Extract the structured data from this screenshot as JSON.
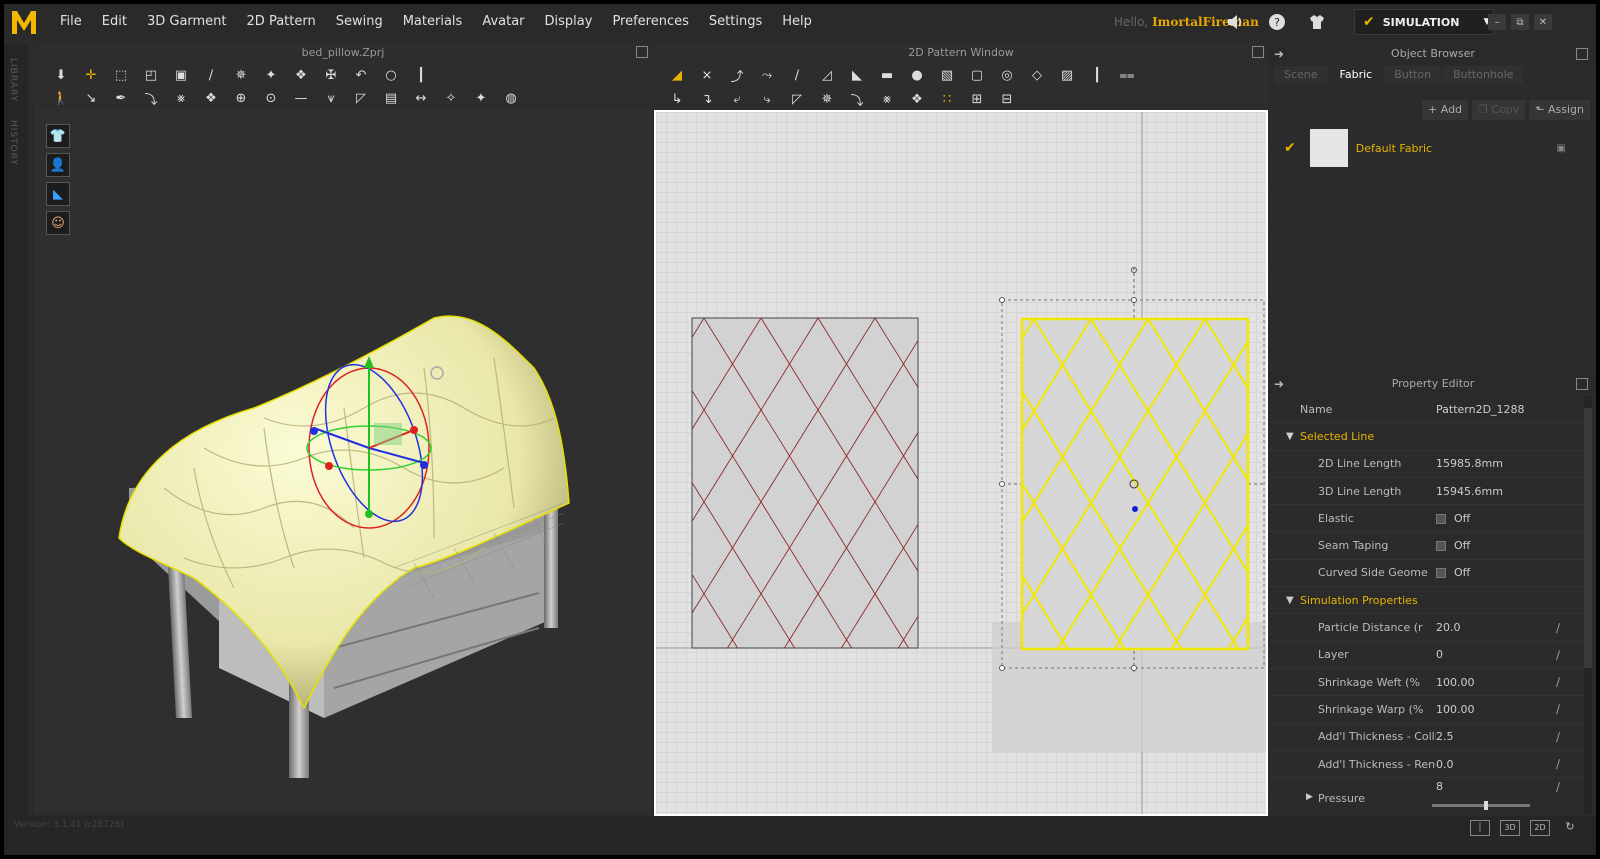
{
  "app": {
    "menu": [
      "File",
      "Edit",
      "3D Garment",
      "2D Pattern",
      "Sewing",
      "Materials",
      "Avatar",
      "Display",
      "Preferences",
      "Settings",
      "Help"
    ],
    "hello_prefix": "Hello,",
    "user_name": "ImortalFireman",
    "mode_label": "SIMULATION",
    "accent_color": "#e8b400"
  },
  "side_tabs": [
    "LIBRARY",
    "HISTORY"
  ],
  "viewport3d": {
    "title": "bed_pillow.Zprj"
  },
  "viewport2d": {
    "title": "2D Pattern Window"
  },
  "object_browser": {
    "title": "Object Browser",
    "tabs": [
      "Scene",
      "Fabric",
      "Button",
      "Buttonhole"
    ],
    "active_tab": "Fabric",
    "buttons": {
      "add": "Add",
      "copy": "Copy",
      "assign": "Assign"
    },
    "fabrics": [
      {
        "name": "Default Fabric",
        "selected": true
      }
    ]
  },
  "property_editor": {
    "title": "Property Editor",
    "name_label": "Name",
    "name_value": "Pattern2D_1288",
    "selected_line_header": "Selected Line",
    "selected_line": [
      {
        "label": "2D Line Length",
        "value": "15985.8mm"
      },
      {
        "label": "3D Line Length",
        "value": "15945.6mm"
      },
      {
        "label": "Elastic",
        "value": "Off",
        "checkbox": true
      },
      {
        "label": "Seam Taping",
        "value": "Off",
        "checkbox": true
      },
      {
        "label": "Curved Side Geome",
        "value": "Off",
        "checkbox": true
      }
    ],
    "simulation_header": "Simulation Properties",
    "simulation": [
      {
        "label": "Particle Distance (r",
        "value": "20.0"
      },
      {
        "label": "Layer",
        "value": "0"
      },
      {
        "label": "Shrinkage Weft (%",
        "value": "100.00"
      },
      {
        "label": "Shrinkage Warp (%",
        "value": "100.00"
      },
      {
        "label": "Add'l Thickness - Collisic",
        "value": "2.5"
      },
      {
        "label": "Add'l Thickness - Render",
        "value": "0.0"
      }
    ],
    "pressure_label": "Pressure",
    "pressure_value": "8"
  },
  "status": {
    "version": "Version: 3.1.41 (r28726)"
  }
}
